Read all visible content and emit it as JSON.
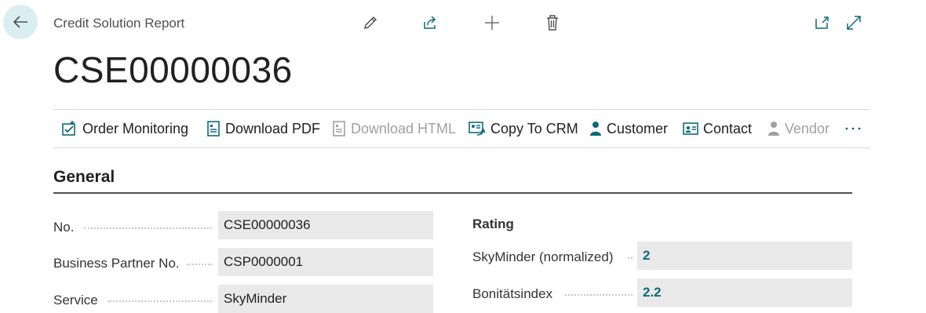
{
  "header": {
    "caption": "Credit Solution Report",
    "title": "CSE00000036"
  },
  "icons": {
    "back": "arrow-left-icon",
    "edit": "pencil-icon",
    "share": "share-icon",
    "new": "plus-icon",
    "delete": "trash-icon",
    "open_new_window": "open-in-new-window-icon",
    "expand": "expand-icon",
    "more": "ellipsis-icon"
  },
  "actions": [
    {
      "label": "Order Monitoring",
      "enabled": true,
      "icon": "order-monitoring-icon"
    },
    {
      "label": "Download PDF",
      "enabled": true,
      "icon": "document-icon"
    },
    {
      "label": "Download HTML",
      "enabled": false,
      "icon": "document-icon"
    },
    {
      "label": "Copy To CRM",
      "enabled": true,
      "icon": "copy-crm-icon"
    },
    {
      "label": "Customer",
      "enabled": true,
      "icon": "person-icon"
    },
    {
      "label": "Contact",
      "enabled": true,
      "icon": "contact-card-icon"
    },
    {
      "label": "Vendor",
      "enabled": false,
      "icon": "person-icon"
    }
  ],
  "general": {
    "section_title": "General",
    "fields": [
      {
        "label": "No.",
        "value": "CSE00000036"
      },
      {
        "label": "Business Partner No.",
        "value": "CSP0000001"
      },
      {
        "label": "Service",
        "value": "SkyMinder"
      }
    ],
    "rating": {
      "title": "Rating",
      "fields": [
        {
          "label": "SkyMinder (normalized)",
          "value": "2"
        },
        {
          "label": "Bonitätsindex",
          "value": "2.2"
        }
      ]
    }
  },
  "colors": {
    "accent": "#0b6a79",
    "back_button_bg": "#daeef2",
    "field_bg": "#e9e9e9",
    "disabled_text": "#a0a0a0"
  }
}
